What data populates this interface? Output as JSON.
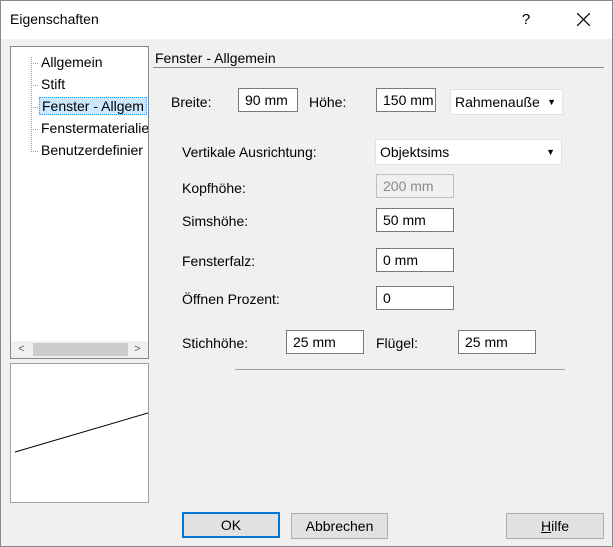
{
  "window": {
    "title": "Eigenschaften",
    "help": "?"
  },
  "tree": {
    "items": [
      {
        "label": "Allgemein"
      },
      {
        "label": "Stift"
      },
      {
        "label": "Fenster - Allgem"
      },
      {
        "label": "Fenstermaterialie"
      },
      {
        "label": "Benutzerdefinier"
      }
    ],
    "selected_index": 2,
    "scroll_left": "<",
    "scroll_right": ">"
  },
  "section": {
    "title": "Fenster - Allgemein"
  },
  "form": {
    "breite_label": "Breite:",
    "breite_value": "90 mm",
    "hoehe_label": "Höhe:",
    "hoehe_value": "150 mm",
    "rahmen_value": "Rahmenauße",
    "vertikale_label": "Vertikale Ausrichtung:",
    "vertikale_value": "Objektsims",
    "kopfhoehe_label": "Kopfhöhe:",
    "kopfhoehe_value": "200 mm",
    "simshoehe_label": "Simshöhe:",
    "simshoehe_value": "50 mm",
    "fensterfalz_label": "Fensterfalz:",
    "fensterfalz_value": "0 mm",
    "oeffnen_label": "Öffnen Prozent:",
    "oeffnen_value": "0",
    "stichhoehe_label": "Stichhöhe:",
    "stichhoehe_value": "25 mm",
    "fluegel_label": "Flügel:",
    "fluegel_value": "25 mm"
  },
  "buttons": {
    "ok": "OK",
    "cancel": "Abbrechen",
    "help_first": "H",
    "help_rest": "ilfe"
  },
  "colors": {
    "selection": "#cce8ff",
    "default_button_border": "#0078d7"
  }
}
